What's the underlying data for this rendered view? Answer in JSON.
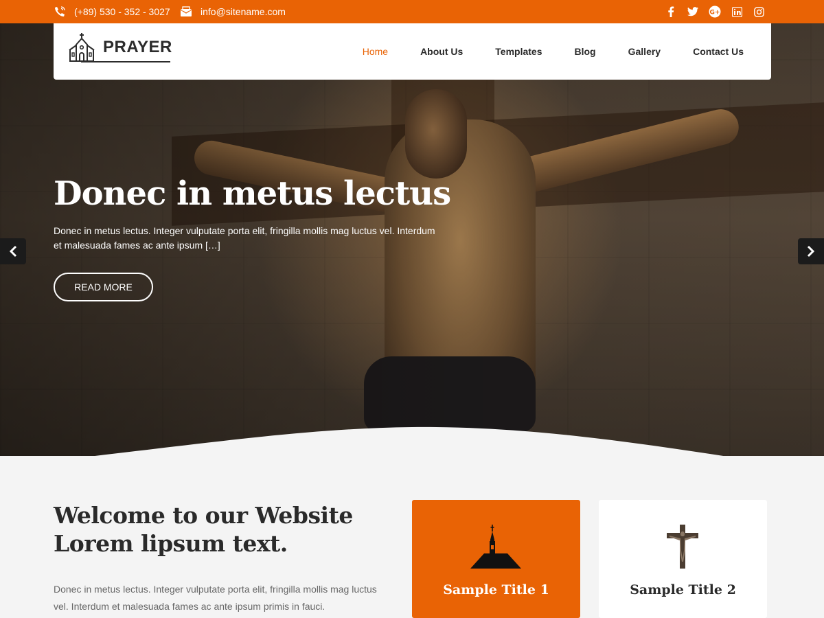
{
  "topbar": {
    "phone": "(+89) 530 - 352 - 3027",
    "email": "info@sitename.com",
    "phone_icon": "phone-icon",
    "email_icon": "envelope-icon",
    "social": [
      "facebook-icon",
      "twitter-icon",
      "google-plus-icon",
      "linkedin-icon",
      "instagram-icon"
    ],
    "bg_color": "#e96305"
  },
  "logo": {
    "text": "PRAYER",
    "icon": "church-icon"
  },
  "nav": {
    "items": [
      {
        "label": "Home",
        "active": true
      },
      {
        "label": "About Us"
      },
      {
        "label": "Templates"
      },
      {
        "label": "Blog"
      },
      {
        "label": "Gallery"
      },
      {
        "label": "Contact Us"
      }
    ],
    "active_color": "#e96305"
  },
  "hero": {
    "title": "Donec in metus lectus",
    "text": "Donec in metus lectus. Integer vulputate porta elit, fringilla mollis mag luctus vel. Interdum et malesuada fames ac ante ipsum […]",
    "button_label": "READ MORE",
    "prev_icon": "chevron-left-icon",
    "next_icon": "chevron-right-icon"
  },
  "welcome": {
    "title": "Welcome to our Website Lorem lipsum text.",
    "text": "Donec in metus lectus. Integer vulputate porta elit, fringilla mollis mag luctus vel. Interdum et malesuada fames ac ante ipsum primis in fauci. Pellentesque in"
  },
  "cards": [
    {
      "title": "Sample Title 1",
      "icon": "church-steeple-icon",
      "bg_color": "#e96305"
    },
    {
      "title": "Sample Title 2",
      "icon": "crucifix-icon",
      "bg_color": "#ffffff"
    }
  ]
}
